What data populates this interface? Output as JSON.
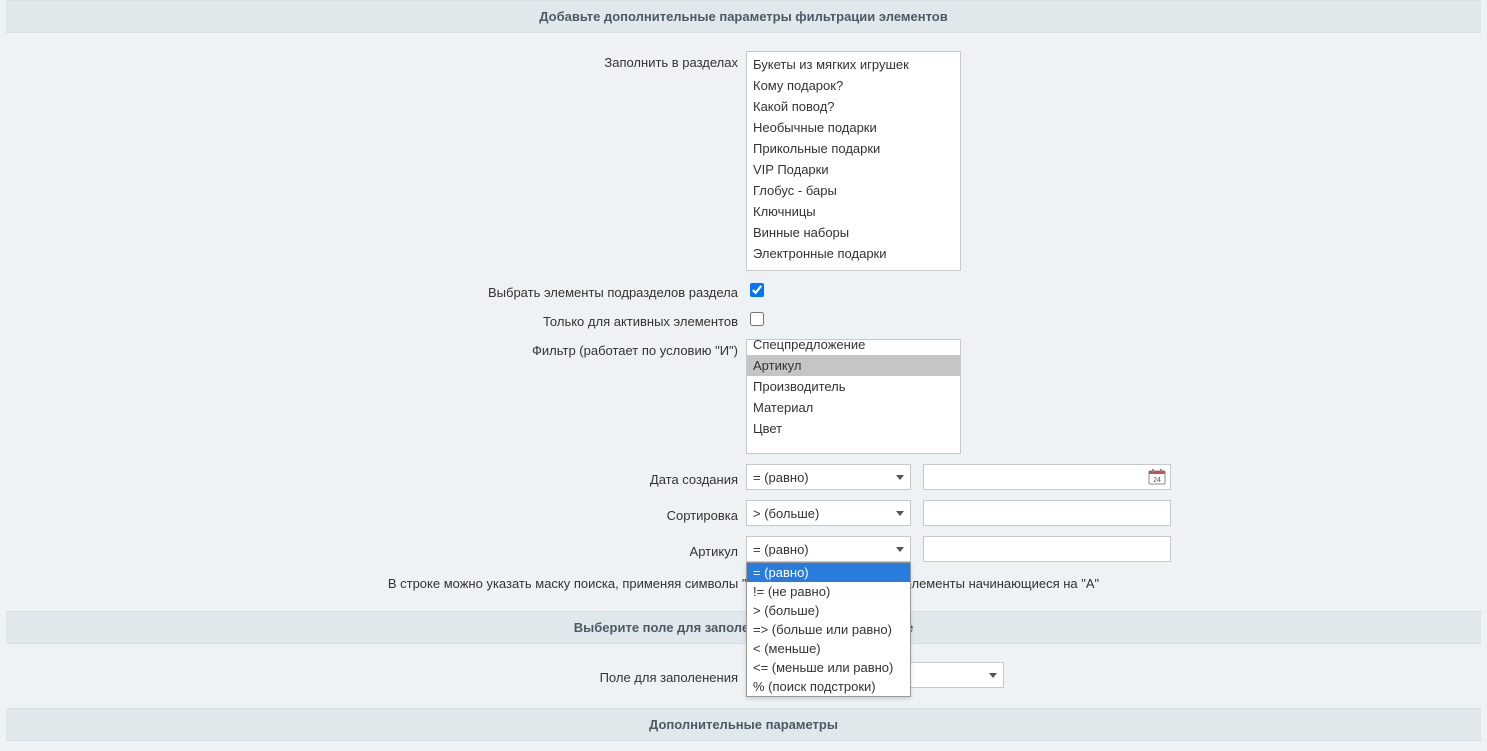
{
  "headers": {
    "filter_params": "Добавьте дополнительные параметры фильтрации элементов",
    "choose_field": "Выберите поле для заполения и его новое значение",
    "additional": "Дополнительные параметры"
  },
  "labels": {
    "fill_sections": "Заполнить в разделах",
    "include_subsections": "Выбрать элементы подразделов раздела",
    "only_active": "Только для активных элементов",
    "filter_and": "Фильтр (работает по условию \"И\")",
    "date_created": "Дата создания",
    "sorting": "Сортировка",
    "article": "Артикул",
    "fill_field": "Поле для заполенения"
  },
  "sections_list": [
    "Букеты из мягких игрушек",
    "Кому подарок?",
    "Какой повод?",
    "Необычные подарки",
    "Прикольные подарки",
    "VIP Подарки",
    "Глобус - бары",
    "Ключницы",
    "Винные наборы",
    "Электронные подарки"
  ],
  "filter_list": [
    "Спецпредложение",
    "Артикул",
    "Производитель",
    "Материал",
    "Цвет"
  ],
  "filter_selected_index": 1,
  "selects": {
    "date_op": "=  (равно)",
    "sort_op": ">  (больше)",
    "article_op": "=  (равно)",
    "fill_field_value": ""
  },
  "inputs": {
    "date_value": "",
    "sort_value": "",
    "article_value": ""
  },
  "checkboxes": {
    "include_subsections": true,
    "only_active": false
  },
  "hint_text": "В строке можно указать маску поиска, применяя символы \"%_\", например \"А%\" - все элементы начинающиеся на \"А\"",
  "dropdown_options": [
    "=  (равно)",
    "!= (не равно)",
    ">  (больше)",
    "=> (больше или равно)",
    "<  (меньше)",
    "<= (меньше или равно)",
    "%  (поиск подстроки)"
  ],
  "dropdown_highlight": 0
}
